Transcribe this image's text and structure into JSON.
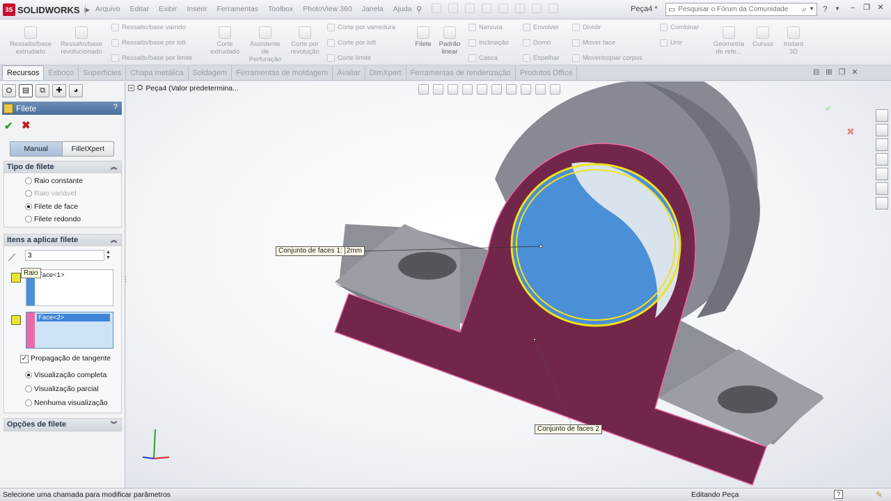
{
  "app": {
    "name": "SOLIDWORKS",
    "document_title": "Peça4 *"
  },
  "menu": [
    "Arquivo",
    "Editar",
    "Exibir",
    "Inserir",
    "Ferramentas",
    "Toolbox",
    "PhotoView 360",
    "Janela",
    "Ajuda"
  ],
  "search": {
    "placeholder": "Pesquisar o Fórum da Comunidade"
  },
  "ribbon": {
    "extruded_boss": "Ressalto/base extrudado",
    "revolved_boss": "Ressalto/base revolucionado",
    "swept_boss": "Ressalto/base varrido",
    "loft_boss": "Ressalto/base por loft",
    "boundary_boss": "Ressalto/base por limite",
    "extruded_cut": "Corte extrudado",
    "hole_wizard": "Assistente de Perfuração",
    "revolved_cut": "Corte por revolução",
    "swept_cut": "Corte por varredura",
    "loft_cut": "Corte por loft",
    "boundary_cut": "Corte limite",
    "fillet": "Filete",
    "linear_pattern": "Padrão linear",
    "rib": "Nervura",
    "draft": "Inclinação",
    "shell": "Casca",
    "wrap": "Envolver",
    "dome": "Domo",
    "mirror": "Espelhar",
    "split": "Dividir",
    "move_face": "Mover face",
    "move_copy_bodies": "Mover/copiar corpos",
    "combine": "Combinar",
    "join": "Unir",
    "ref_geometry": "Geometria de refe...",
    "curves": "Curvas",
    "instant3d": "Instant 3D"
  },
  "tabs": [
    "Recursos",
    "Esboço",
    "Superfícies",
    "Chapa metálica",
    "Soldagem",
    "Ferramentas de moldagem",
    "Avaliar",
    "DimXpert",
    "Ferramentas de renderização",
    "Produtos Office"
  ],
  "active_tab": "Recursos",
  "property_manager": {
    "title": "Filete",
    "help": "?",
    "mode_tabs": [
      "Manual",
      "FilletXpert"
    ],
    "active_mode": "Manual",
    "fillet_type": {
      "heading": "Tipo de filete",
      "options": [
        {
          "label": "Raio constante",
          "selected": false,
          "enabled": true
        },
        {
          "label": "Raio variável",
          "selected": false,
          "enabled": false
        },
        {
          "label": "Filete de face",
          "selected": true,
          "enabled": true
        },
        {
          "label": "Filete redondo",
          "selected": false,
          "enabled": true
        }
      ]
    },
    "items": {
      "heading": "Itens a aplicar filete",
      "radius_value": "3",
      "tooltip": "Raio",
      "face_set_1": "Face<1>",
      "face_set_2": "Face<2>",
      "tangent_propagation_label": "Propagação de tangente",
      "tangent_propagation_checked": true,
      "preview_options": [
        {
          "label": "Visualização completa",
          "selected": true
        },
        {
          "label": "Visualização parcial",
          "selected": false
        },
        {
          "label": "Nenhuma visualização",
          "selected": false
        }
      ]
    },
    "options_heading": "Opções de filete"
  },
  "viewport": {
    "tree_label": "Peça4  (Valor predetermina...",
    "callout_1_label": "Conjunto de faces 1:",
    "callout_1_value": "2mm",
    "callout_2_label": "Conjunto de faces 2"
  },
  "status": {
    "message": "Selecione uma chamada para modificar parâmetros",
    "mode": "Editando Peça",
    "help": "?"
  },
  "colors": {
    "face_set_1": "#4b8fd6",
    "face_set_2": "#7a2a4a",
    "selection_highlight": "#f2e21a",
    "edge_pink": "#e86aa8",
    "header_blue": "#4a6f9c"
  }
}
